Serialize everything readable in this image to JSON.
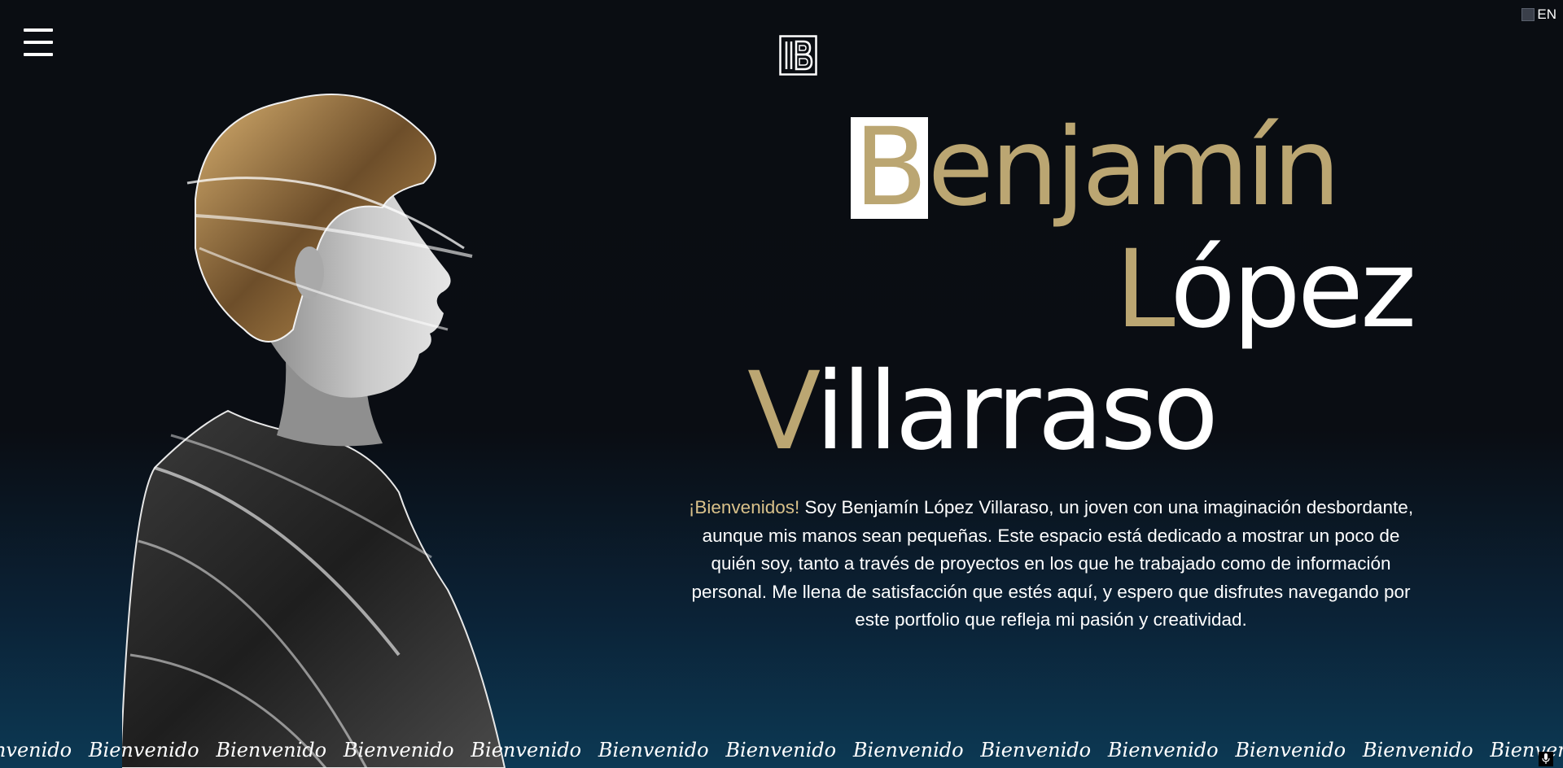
{
  "header": {
    "language_label": "EN"
  },
  "hero": {
    "name_line1_initial": "B",
    "name_line1_rest": "enjamín",
    "name_line2_initial": "L",
    "name_line2_rest": "ópez",
    "name_line3_initial": "V",
    "name_line3_rest": "illarraso",
    "intro_highlight": "¡Bienvenidos!",
    "intro_lines": [
      " Soy Benjamín López Villaraso, un joven con una imaginación desbordante,",
      "aunque mis manos sean pequeñas. Este espacio está dedicado a mostrar un poco de",
      "quién soy, tanto a través de proyectos en los que he trabajado como de información",
      "personal. Me llena de satisfacción que estés aquí, y espero que disfrutes navegando por",
      "este portfolio que refleja mi pasión y creatividad."
    ]
  },
  "marquee": {
    "items": [
      "Bienvenido",
      "Bienvenido",
      "Bienvenido",
      "Bienvenido",
      "Bienvenido",
      "Bienvenido",
      "Bienvenido",
      "Bienvenido",
      "Bienvenido",
      "Bienvenido",
      "Bienvenido",
      "Bienvenido",
      "Bienvenido"
    ]
  },
  "colors": {
    "accent_gold": "#bba672",
    "highlight_gold": "#d9c18a",
    "background_top": "#0a0d12",
    "background_bottom": "#0c3954"
  },
  "icons": {
    "menu": "hamburger-icon",
    "flag": "flag-icon",
    "logo": "logo-monogram-b",
    "mic": "microphone-icon"
  }
}
